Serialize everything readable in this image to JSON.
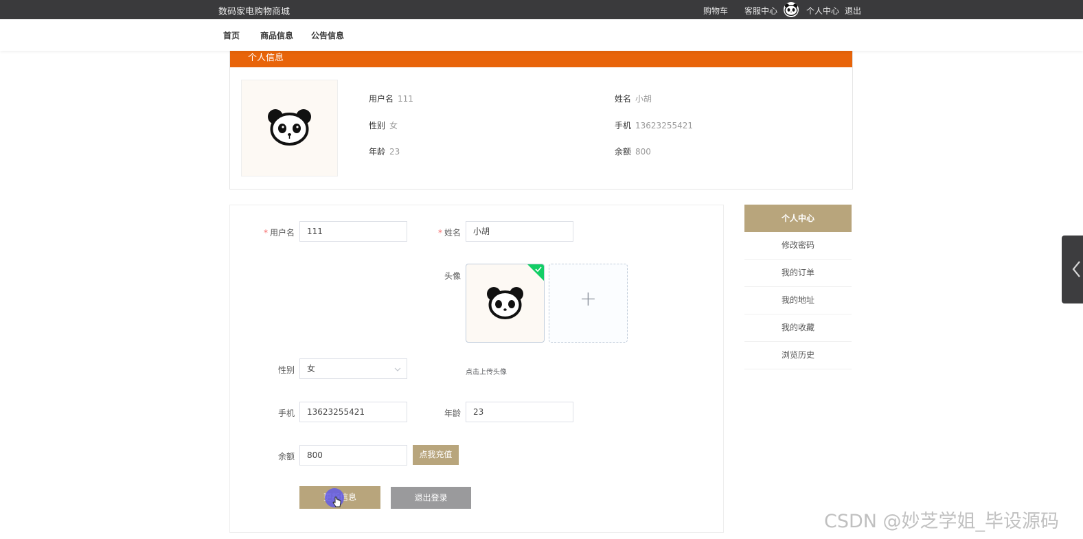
{
  "topbar": {
    "brand": "数码家电购物商城",
    "cart": "购物车",
    "service": "客服中心",
    "profile": "个人中心",
    "logout": "退出"
  },
  "nav": {
    "items": [
      "首页",
      "商品信息",
      "公告信息"
    ]
  },
  "info": {
    "title": "个人信息",
    "username_label": "用户名",
    "username": "111",
    "name_label": "姓名",
    "name": "小胡",
    "gender_label": "性别",
    "gender": "女",
    "phone_label": "手机",
    "phone": "13623255421",
    "age_label": "年龄",
    "age": "23",
    "balance_label": "余额",
    "balance": "800"
  },
  "form": {
    "required_mark": "*",
    "username_label": "用户名",
    "username_value": "111",
    "name_label": "姓名",
    "name_value": "小胡",
    "avatar_label": "头像",
    "upload_hint": "点击上传头像",
    "upload_plus": "+",
    "gender_label": "性别",
    "gender_value": "女",
    "phone_label": "手机",
    "phone_value": "13623255421",
    "age_label": "年龄",
    "age_value": "23",
    "balance_label": "余额",
    "balance_value": "800",
    "recharge_button": "点我充值",
    "update_button": "更新信息",
    "logout_button": "退出登录"
  },
  "sidebar": {
    "title": "个人中心",
    "items": [
      "修改密码",
      "我的订单",
      "我的地址",
      "我的收藏",
      "浏览历史"
    ]
  },
  "watermark": "CSDN @妙芝学姐_毕设源码",
  "colors": {
    "accent": "#b8a57c",
    "header_orange": "#e8640a",
    "topbar": "#3a3a3c",
    "success": "#13ce66"
  },
  "icons": [
    "panda-avatar-icon",
    "chevron-down-icon",
    "check-icon",
    "chevron-left-icon",
    "hand-cursor-icon"
  ]
}
